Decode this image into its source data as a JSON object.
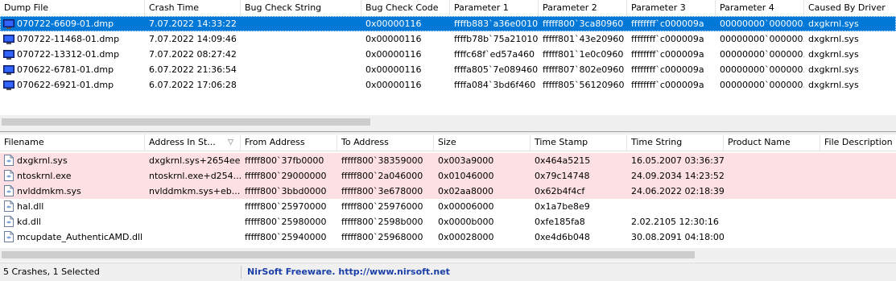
{
  "crashes": {
    "columns": [
      "Dump File",
      "Crash Time",
      "Bug Check String",
      "Bug Check Code",
      "Parameter 1",
      "Parameter 2",
      "Parameter 3",
      "Parameter 4",
      "Caused By Driver"
    ],
    "rows": [
      {
        "icon": "crash-dump-icon",
        "selected": true,
        "cells": [
          "070722-6609-01.dmp",
          "7.07.2022 14:33:22",
          "",
          "0x00000116",
          "ffffb883`a36e0010",
          "fffff800`3ca80960",
          "ffffffff`c000009a",
          "00000000`000000...",
          "dxgkrnl.sys"
        ]
      },
      {
        "icon": "crash-dump-icon",
        "selected": false,
        "cells": [
          "070722-11468-01.dmp",
          "7.07.2022 14:09:46",
          "",
          "0x00000116",
          "ffffb78b`75a21010",
          "fffff801`43e20960",
          "ffffffff`c000009a",
          "00000000`000000...",
          "dxgkrnl.sys"
        ]
      },
      {
        "icon": "crash-dump-icon",
        "selected": false,
        "cells": [
          "070722-13312-01.dmp",
          "7.07.2022 08:27:42",
          "",
          "0x00000116",
          "ffffc68f`ed57a460",
          "fffff801`1e0c0960",
          "ffffffff`c000009a",
          "00000000`000000...",
          "dxgkrnl.sys"
        ]
      },
      {
        "icon": "crash-dump-icon",
        "selected": false,
        "cells": [
          "070622-6781-01.dmp",
          "6.07.2022 21:36:54",
          "",
          "0x00000116",
          "ffffa805`7e089460",
          "fffff807`802e0960",
          "ffffffff`c000009a",
          "00000000`000000...",
          "dxgkrnl.sys"
        ]
      },
      {
        "icon": "crash-dump-icon",
        "selected": false,
        "cells": [
          "070622-6921-01.dmp",
          "6.07.2022 17:06:28",
          "",
          "0x00000116",
          "ffffa084`3bd6f460",
          "fffff805`56120960",
          "ffffffff`c000009a",
          "00000000`000000...",
          "dxgkrnl.sys"
        ]
      }
    ]
  },
  "modules": {
    "columns": [
      "Filename",
      "Address In St...",
      "From Address",
      "To Address",
      "Size",
      "Time Stamp",
      "Time String",
      "Product Name",
      "File Description"
    ],
    "sorted_column": "Address In St...",
    "rows": [
      {
        "highlight": true,
        "cells": [
          "dxgkrnl.sys",
          "dxgkrnl.sys+2654ee",
          "fffff800`37fb0000",
          "fffff800`38359000",
          "0x003a9000",
          "0x464a5215",
          "16.05.2007 03:36:37",
          "",
          ""
        ]
      },
      {
        "highlight": true,
        "cells": [
          "ntoskrnl.exe",
          "ntoskrnl.exe+d254...",
          "fffff800`29000000",
          "fffff800`2a046000",
          "0x01046000",
          "0x79c14748",
          "24.09.2034 14:23:52",
          "",
          ""
        ]
      },
      {
        "highlight": true,
        "cells": [
          "nvlddmkm.sys",
          "nvlddmkm.sys+eb...",
          "fffff800`3bbd0000",
          "fffff800`3e678000",
          "0x02aa8000",
          "0x62b4f4cf",
          "24.06.2022 02:18:39",
          "",
          ""
        ]
      },
      {
        "highlight": false,
        "cells": [
          "hal.dll",
          "",
          "fffff800`25970000",
          "fffff800`25976000",
          "0x00006000",
          "0x1a7be8e9",
          "",
          "",
          ""
        ]
      },
      {
        "highlight": false,
        "cells": [
          "kd.dll",
          "",
          "fffff800`25980000",
          "fffff800`2598b000",
          "0x0000b000",
          "0xfe185fa8",
          "2.02.2105 12:30:16",
          "",
          ""
        ]
      },
      {
        "highlight": false,
        "cells": [
          "mcupdate_AuthenticAMD.dll",
          "",
          "fffff800`25940000",
          "fffff800`25968000",
          "0x00028000",
          "0xe4d6b048",
          "30.08.2091 04:18:00",
          "",
          ""
        ]
      }
    ]
  },
  "status": {
    "summary": "5 Crashes, 1 Selected",
    "link": "NirSoft Freeware.  http://www.nirsoft.net"
  },
  "colors": {
    "selection": "#0078d7",
    "highlight_row": "#fde0e3",
    "link": "#1a3fa8"
  }
}
